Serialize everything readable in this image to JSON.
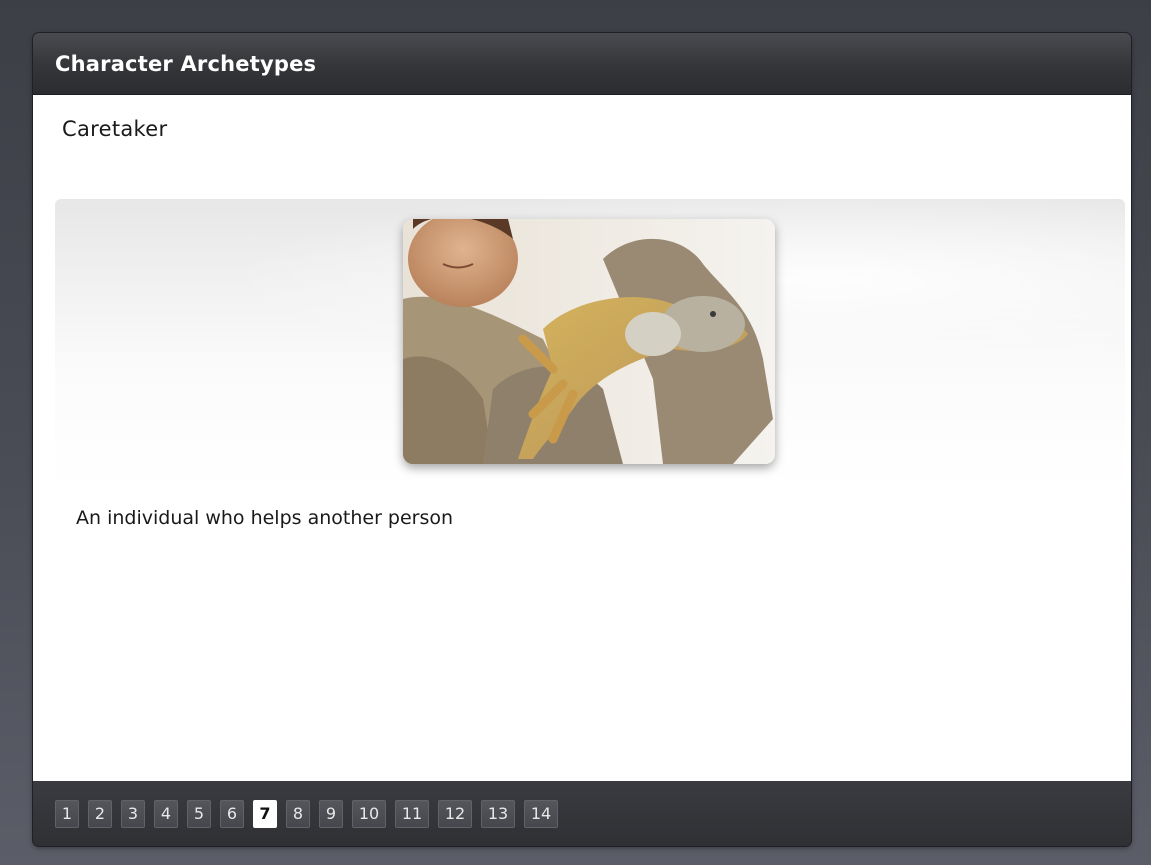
{
  "header": {
    "title": "Character Archetypes"
  },
  "slide": {
    "heading": "Caretaker",
    "image_alt": "person holding an iguana",
    "description": "An individual who helps another person"
  },
  "pager": {
    "pages": [
      "1",
      "2",
      "3",
      "4",
      "5",
      "6",
      "7",
      "8",
      "9",
      "10",
      "11",
      "12",
      "13",
      "14"
    ],
    "current": "7"
  },
  "colors": {
    "background": "#464852",
    "titlebar": "#36373b",
    "pager_bg": "#333438",
    "active_page": "#ffffff"
  }
}
